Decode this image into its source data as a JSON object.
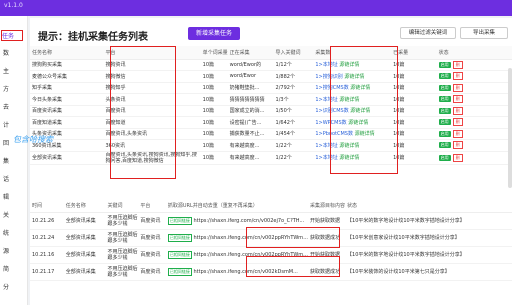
{
  "app": {
    "version": "v1.1.0",
    "accent": "#6d2ee0",
    "sidebar_highlight": "#e02020"
  },
  "sidebar": {
    "items": [
      {
        "label": "任务"
      },
      {
        "label": "数"
      },
      {
        "label": "主"
      },
      {
        "label": "方"
      },
      {
        "label": "去"
      },
      {
        "label": "计"
      },
      {
        "label": "回"
      },
      {
        "label": "集"
      },
      {
        "label": "话"
      },
      {
        "label": "辑"
      },
      {
        "label": "关"
      },
      {
        "label": "统"
      },
      {
        "label": "源"
      },
      {
        "label": "简"
      },
      {
        "label": "分"
      },
      {
        "label": "项"
      },
      {
        "label": "消"
      },
      {
        "label": "账"
      },
      {
        "label": "设"
      }
    ]
  },
  "header": {
    "title": "提示：挂机采集任务列表",
    "new_task_label": "新增采集任务",
    "btn_edit_keywords": "编辑过滤关键词",
    "btn_export": "导出采集"
  },
  "task_table": {
    "columns": [
      "任务名称",
      "平台",
      "单个词采量",
      "正在采集",
      "导入关键词",
      "采集数",
      "已采量",
      "状态"
    ],
    "rows": [
      {
        "name": "搜狗购买采集",
        "platform": "搜狗资讯",
        "per": "10篇",
        "current": "word/Ewor的",
        "keywords": "1/12个",
        "status_text": "1>本地址",
        "link": "源链详情",
        "count": "10篇"
      },
      {
        "name": "麦德公众号采集",
        "platform": "搜狗微信",
        "per": "10篇",
        "current": "word/Ewor",
        "keywords": "1/882个",
        "status_text": "1>搜狗识别",
        "link": "源链详情",
        "count": "10篇"
      },
      {
        "name": "知乎采集",
        "platform": "搜狗知乎",
        "per": "10篇",
        "current": "奶猪鞋垫批...",
        "keywords": "2/792个",
        "status_text": "1>搜狗CMS数",
        "link": "源链详情",
        "count": "10篇"
      },
      {
        "name": "今日头条采集",
        "platform": "头条资讯",
        "per": "10篇",
        "current": "猜猜猜猜猜猜猜",
        "keywords": "1/3个",
        "status_text": "1>本地址",
        "link": "源链详情",
        "count": "10篇"
      },
      {
        "name": "百度资讯采集",
        "platform": "百度资讯",
        "per": "10篇",
        "current": "国家成立的消...",
        "keywords": "1/50个",
        "status_text": "1>识别CMS数",
        "link": "源链详情",
        "count": "10篇"
      },
      {
        "name": "百度知道采集",
        "platform": "百度知道",
        "per": "10篇",
        "current": "设密提(广告...",
        "keywords": "1/642个",
        "status_text": "1>WPCMS数",
        "link": "源链详情",
        "count": "10篇"
      },
      {
        "name": "头条资讯采集",
        "platform": "百度资讯,头条资讯",
        "per": "10篇",
        "current": "捕获数量不止...",
        "keywords": "1/454个",
        "status_text": "1>PbootCMS数",
        "link": "源链详情",
        "count": "10篇"
      },
      {
        "name": "360资讯采集",
        "platform": "360资讯",
        "per": "10篇",
        "current": "有来越高度...",
        "keywords": "1/22个",
        "status_text": "1>本地址",
        "link": "源链详情",
        "count": "10篇"
      },
      {
        "name": "全部资讯采集",
        "platform": "百度资讯,头条资讯,搜狗资讯,搜狗知乎,搜狗问答,百度知道,搜狗微信",
        "per": "10篇",
        "current": "有来越高度...",
        "keywords": "1/22个",
        "status_text": "1>本地址",
        "link": "源链详情",
        "count": "10篇"
      }
    ],
    "status_on": "启用",
    "status_del": "删"
  },
  "annotation": "包含哈搜索",
  "log_table": {
    "columns": [
      "时间",
      "任务名称",
      "关键词",
      "平台",
      "抓取源URL并自动去重（重复不再采集）",
      "采集源目标内容",
      "状态"
    ],
    "rows": [
      {
        "time": "10.21.26",
        "task": "全部资讯采集",
        "kw": "不用压迫脚后跟多少钱",
        "platform": "百度资讯",
        "tag": "已相同链接",
        "url": "https://shaxn.iferg.com/cn/v002ej7o_C?TH...",
        "status": "开始获取数据",
        "content": "【10平米的数字地设计纹10平米数字插地设计分享】"
      },
      {
        "time": "10.21.24",
        "task": "全部资讯采集",
        "kw": "不用压迫脚后跟多少钱",
        "platform": "百度资讯",
        "tag": "已相同链接",
        "url": "https://shaxn.ifeng.com/cn/v002ppRYhTWrn...",
        "status": "获取数据成功",
        "content": "【10平米创意家设计纹10平米数字插地设计分享】"
      },
      {
        "time": "10.21.16",
        "task": "全部资讯采集",
        "kw": "不用压迫脚后跟多少钱",
        "platform": "百度资讯",
        "tag": "已相同链接",
        "url": "https://shaxn.ifeng.com/cn/v002ppRYhTWm...",
        "status": "开始获取数据",
        "content": "【10平米的数字地设计纹10平米数字插地设计分享】"
      },
      {
        "time": "10.21.17",
        "task": "全部资讯采集",
        "kw": "不用压迫脚后跟多少钱",
        "platform": "百度资讯",
        "tag": "已相同链接",
        "url": "https://shaxn.ifeng.com/cn/v002kDsmM...",
        "status": "获取数据成功",
        "content": "【10平米装饰的设计纹10平米第七只是分享】"
      }
    ]
  }
}
